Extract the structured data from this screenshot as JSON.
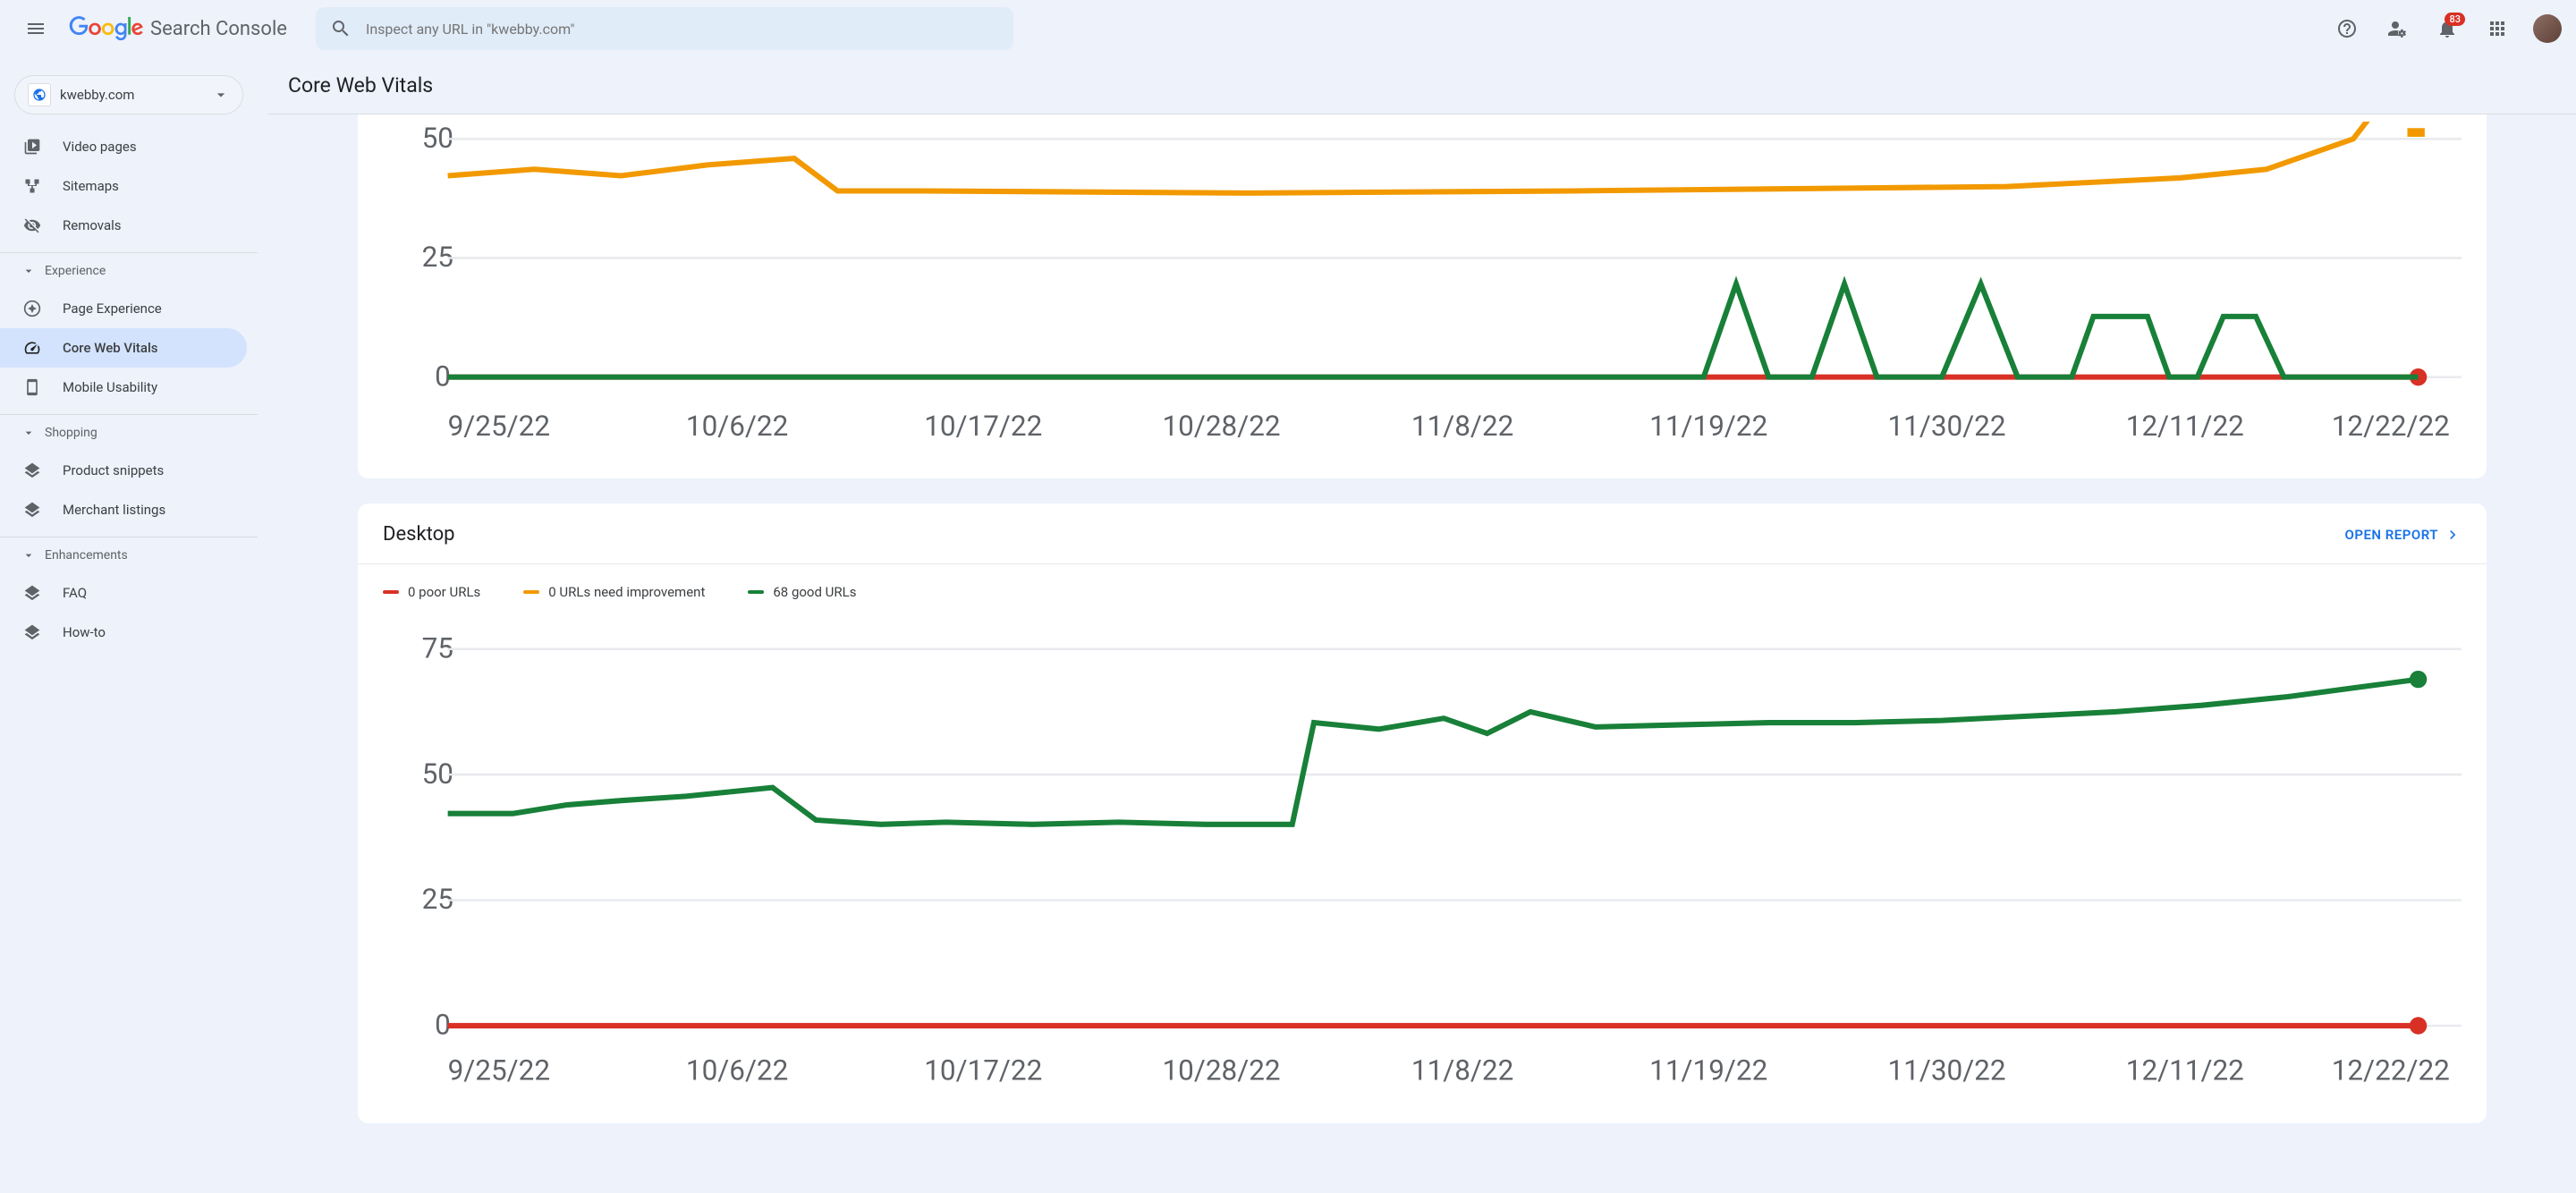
{
  "header": {
    "product_name": "Search Console",
    "search_placeholder": "Inspect any URL in \"kwebby.com\"",
    "notif_count": "83"
  },
  "property": {
    "domain": "kwebby.com"
  },
  "sidebar": {
    "video_pages": "Video pages",
    "sitemaps": "Sitemaps",
    "removals": "Removals",
    "section_experience": "Experience",
    "page_experience": "Page Experience",
    "core_web_vitals": "Core Web Vitals",
    "mobile_usability": "Mobile Usability",
    "section_shopping": "Shopping",
    "product_snippets": "Product snippets",
    "merchant_listings": "Merchant listings",
    "section_enhancements": "Enhancements",
    "faq": "FAQ",
    "howto": "How-to"
  },
  "page": {
    "title": "Core Web Vitals"
  },
  "colors": {
    "poor": "#d93025",
    "improve": "#f29900",
    "good": "#188038"
  },
  "mobile_card": {
    "y_ticks": [
      "0",
      "25",
      "50"
    ],
    "x_ticks": [
      "9/25/22",
      "10/6/22",
      "10/17/22",
      "10/28/22",
      "11/8/22",
      "11/19/22",
      "11/30/22",
      "12/11/22",
      "12/22/22"
    ]
  },
  "desktop_card": {
    "title": "Desktop",
    "open_report": "OPEN REPORT",
    "legend_poor": "0 poor URLs",
    "legend_improve": "0 URLs need improvement",
    "legend_good": "68 good URLs",
    "y_ticks": [
      "0",
      "25",
      "50",
      "75"
    ],
    "x_ticks": [
      "9/25/22",
      "10/6/22",
      "10/17/22",
      "10/28/22",
      "11/8/22",
      "11/19/22",
      "11/30/22",
      "12/11/22",
      "12/22/22"
    ]
  },
  "chart_data": [
    {
      "type": "line",
      "title": "Mobile (partial view)",
      "xlabel": "",
      "ylabel": "",
      "ylim": [
        0,
        50
      ],
      "x": [
        "9/25/22",
        "10/6/22",
        "10/17/22",
        "10/28/22",
        "11/8/22",
        "11/19/22",
        "11/30/22",
        "12/11/22",
        "12/22/22"
      ],
      "series": [
        {
          "name": "poor URLs",
          "color": "#d93025",
          "values": [
            0,
            0,
            0,
            0,
            0,
            0,
            0,
            0,
            0
          ]
        },
        {
          "name": "URLs need improvement",
          "color": "#f29900",
          "values": [
            42,
            44,
            40,
            40,
            40,
            40,
            41,
            43,
            55
          ]
        },
        {
          "name": "good URLs",
          "color": "#188038",
          "values": [
            0,
            0,
            0,
            0,
            0,
            10,
            10,
            10,
            0
          ]
        }
      ]
    },
    {
      "type": "line",
      "title": "Desktop",
      "xlabel": "",
      "ylabel": "",
      "ylim": [
        0,
        75
      ],
      "x": [
        "9/25/22",
        "10/6/22",
        "10/17/22",
        "10/28/22",
        "11/8/22",
        "11/19/22",
        "11/30/22",
        "12/11/22",
        "12/22/22"
      ],
      "series": [
        {
          "name": "poor URLs",
          "color": "#d93025",
          "values": [
            0,
            0,
            0,
            0,
            0,
            0,
            0,
            0,
            0
          ]
        },
        {
          "name": "URLs need improvement",
          "color": "#f29900",
          "values": [
            0,
            0,
            0,
            0,
            0,
            0,
            0,
            0,
            0
          ]
        },
        {
          "name": "good URLs",
          "color": "#188038",
          "values": [
            42,
            44,
            40,
            40,
            60,
            60,
            60,
            63,
            68
          ]
        }
      ]
    }
  ]
}
